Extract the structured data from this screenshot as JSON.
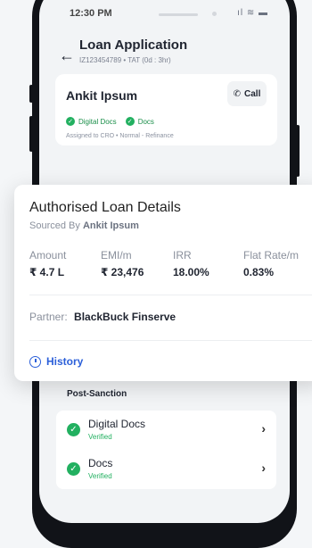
{
  "status_bar": {
    "time": "12:30 PM",
    "icons": "ıl ≋ ▬"
  },
  "header": {
    "title": "Loan Application",
    "subtitle": "IZ123454789 • TAT (0d : 3hr)"
  },
  "customer": {
    "name": "Ankit Ipsum",
    "call_label": "Call",
    "tags": [
      "Digital Docs",
      "Docs"
    ],
    "assigned": "Assigned to CRO • Normal - Refinance"
  },
  "auth_card": {
    "title": "Authorised Loan Details",
    "sourced_prefix": "Sourced By",
    "sourced_name": "Ankit Ipsum",
    "metrics": [
      {
        "label": "Amount",
        "value": "₹ 4.7 L"
      },
      {
        "label": "EMI/m",
        "value": "₹ 23,476"
      },
      {
        "label": "IRR",
        "value": "18.00%"
      },
      {
        "label": "Flat Rate/m",
        "value": "0.83%"
      }
    ],
    "partner_label": "Partner:",
    "partner_name": "BlackBuck Finserve",
    "history_label": "History"
  },
  "post_sanction": {
    "title": "Post-Sanction",
    "items": [
      {
        "title": "Digital Docs",
        "status": "Verified"
      },
      {
        "title": "Docs",
        "status": "Verified"
      }
    ]
  },
  "colors": {
    "accent_blue": "#2b5fd9",
    "success_green": "#22b060"
  }
}
